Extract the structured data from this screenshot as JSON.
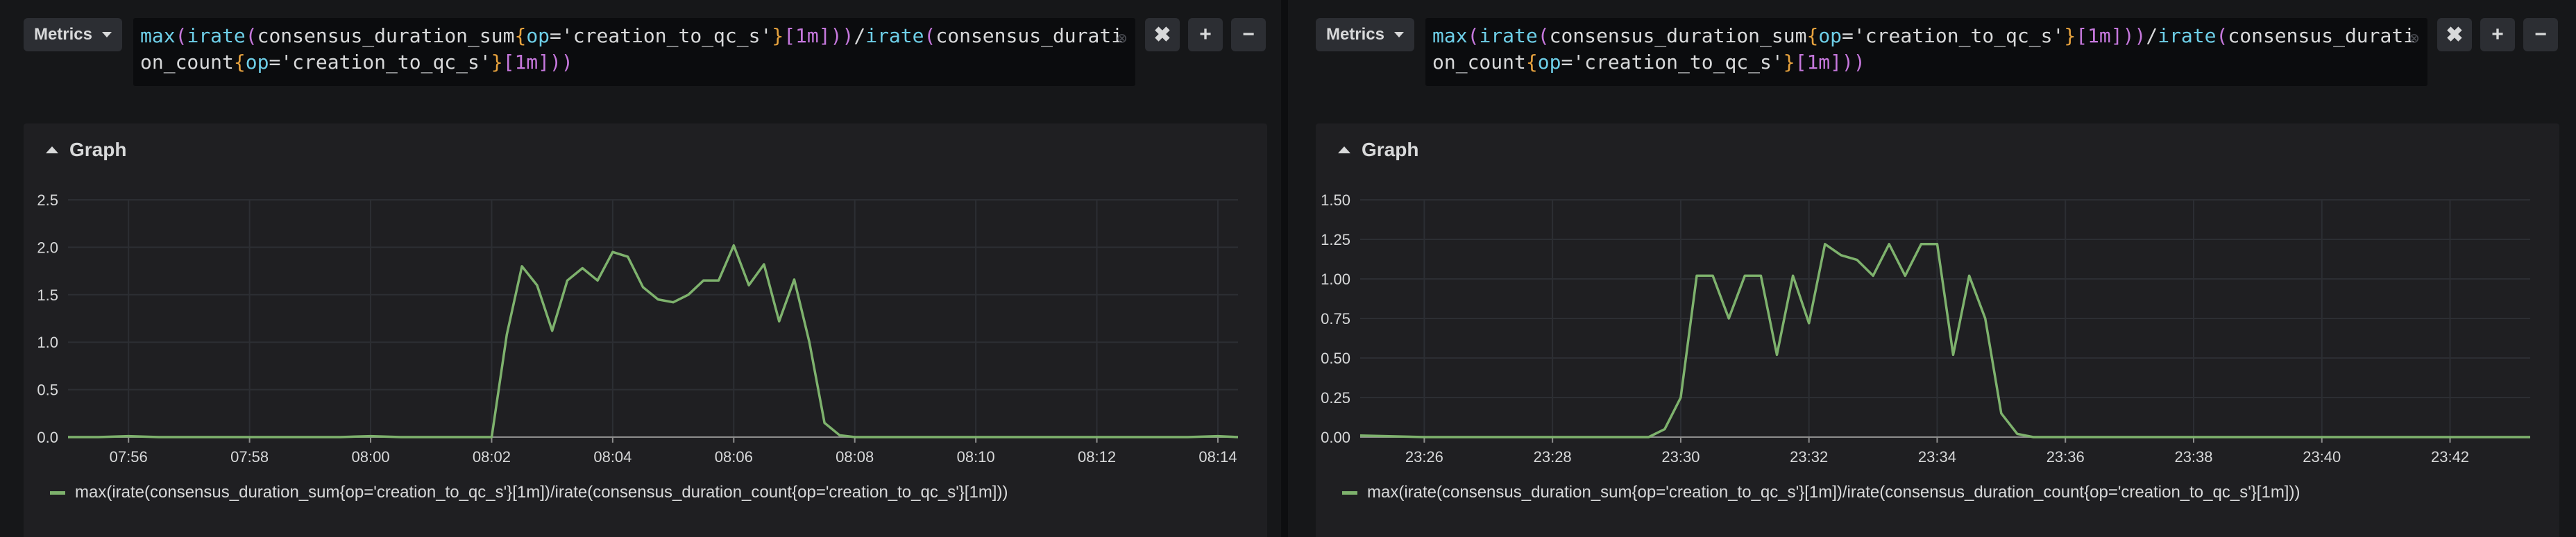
{
  "panels": [
    {
      "datasource_label": "Metrics",
      "query": {
        "segments": [
          {
            "t": "max",
            "c": "q-fn"
          },
          {
            "t": "(",
            "c": "q-par"
          },
          {
            "t": "irate",
            "c": "q-fn"
          },
          {
            "t": "(",
            "c": "q-par"
          },
          {
            "t": "consensus_duration_sum",
            "c": "q-metric"
          },
          {
            "t": "{",
            "c": "q-br"
          },
          {
            "t": "op",
            "c": "q-lbl"
          },
          {
            "t": "=",
            "c": "q-metric"
          },
          {
            "t": "'creation_to_qc_s'",
            "c": "q-metric"
          },
          {
            "t": "}",
            "c": "q-br"
          },
          {
            "t": "[1m]",
            "c": "q-dur"
          },
          {
            "t": ")",
            "c": "q-par"
          },
          {
            "t": ")",
            "c": "q-par"
          },
          {
            "t": "/",
            "c": "q-metric"
          },
          {
            "t": "irate",
            "c": "q-fn"
          },
          {
            "t": "(",
            "c": "q-par"
          },
          {
            "t": "consensus_duration_count",
            "c": "q-metric"
          },
          {
            "t": "{",
            "c": "q-br"
          },
          {
            "t": "op",
            "c": "q-lbl"
          },
          {
            "t": "=",
            "c": "q-metric"
          },
          {
            "t": "'creation_to_qc_s'",
            "c": "q-metric"
          },
          {
            "t": "}",
            "c": "q-br"
          },
          {
            "t": "[1m]",
            "c": "q-dur"
          },
          {
            "t": ")",
            "c": "q-par"
          },
          {
            "t": ")",
            "c": "q-par"
          }
        ]
      },
      "buttons": {
        "remove": "✖",
        "add": "+",
        "minus": "−"
      },
      "graph_title": "Graph",
      "legend": "max(irate(consensus_duration_sum{op='creation_to_qc_s'}[1m])/irate(consensus_duration_count{op='creation_to_qc_s'}[1m]))"
    },
    {
      "datasource_label": "Metrics",
      "query": {
        "segments": [
          {
            "t": "max",
            "c": "q-fn"
          },
          {
            "t": "(",
            "c": "q-par"
          },
          {
            "t": "irate",
            "c": "q-fn"
          },
          {
            "t": "(",
            "c": "q-par"
          },
          {
            "t": "consensus_duration_sum",
            "c": "q-metric"
          },
          {
            "t": "{",
            "c": "q-br"
          },
          {
            "t": "op",
            "c": "q-lbl"
          },
          {
            "t": "=",
            "c": "q-metric"
          },
          {
            "t": "'creation_to_qc_s'",
            "c": "q-metric"
          },
          {
            "t": "}",
            "c": "q-br"
          },
          {
            "t": "[1m]",
            "c": "q-dur"
          },
          {
            "t": ")",
            "c": "q-par"
          },
          {
            "t": ")",
            "c": "q-par"
          },
          {
            "t": "/",
            "c": "q-metric"
          },
          {
            "t": "irate",
            "c": "q-fn"
          },
          {
            "t": "(",
            "c": "q-par"
          },
          {
            "t": "consensus_duration_count",
            "c": "q-metric"
          },
          {
            "t": "{",
            "c": "q-br"
          },
          {
            "t": "op",
            "c": "q-lbl"
          },
          {
            "t": "=",
            "c": "q-metric"
          },
          {
            "t": "'creation_to_qc_s'",
            "c": "q-metric"
          },
          {
            "t": "}",
            "c": "q-br"
          },
          {
            "t": "[1m]",
            "c": "q-dur"
          },
          {
            "t": ")",
            "c": "q-par"
          },
          {
            "t": ")",
            "c": "q-par"
          }
        ]
      },
      "buttons": {
        "remove": "✖",
        "add": "+",
        "minus": "−"
      },
      "graph_title": "Graph",
      "legend": "max(irate(consensus_duration_sum{op='creation_to_qc_s'}[1m])/irate(consensus_duration_count{op='creation_to_qc_s'}[1m]))"
    }
  ],
  "chart_data": [
    {
      "type": "line",
      "title": "Graph",
      "line_color": "#7eb26d",
      "grid": true,
      "legend_position": "bottom-left",
      "x_ticks": [
        "07:56",
        "07:58",
        "08:00",
        "08:02",
        "08:04",
        "08:06",
        "08:08",
        "08:10",
        "08:12",
        "08:14"
      ],
      "y_ticks": [
        "0.0",
        "0.5",
        "1.0",
        "1.5",
        "2.0",
        "2.5"
      ],
      "ylim": [
        0,
        2.5
      ],
      "xlim": [
        "07:55",
        "08:14.333"
      ],
      "series": [
        {
          "name": "max(irate(consensus_duration_sum{op='creation_to_qc_s'}[1m])/irate(consensus_duration_count{op='creation_to_qc_s'}[1m]))",
          "x": [
            "07:55",
            "07:55:30",
            "07:56",
            "07:56:30",
            "07:57",
            "07:57:30",
            "07:58",
            "07:58:30",
            "07:59",
            "07:59:30",
            "08:00",
            "08:00:30",
            "08:01",
            "08:01:30",
            "08:02",
            "08:02:15",
            "08:02:30",
            "08:02:45",
            "08:03",
            "08:03:15",
            "08:03:30",
            "08:03:45",
            "08:04",
            "08:04:15",
            "08:04:30",
            "08:04:45",
            "08:05",
            "08:05:15",
            "08:05:30",
            "08:05:45",
            "08:06",
            "08:06:15",
            "08:06:30",
            "08:06:45",
            "08:07",
            "08:07:15",
            "08:07:30",
            "08:07:45",
            "08:08",
            "08:08:30",
            "08:09",
            "08:09:30",
            "08:10",
            "08:10:30",
            "08:11",
            "08:11:30",
            "08:12",
            "08:12:30",
            "08:13",
            "08:13:30",
            "08:14",
            "08:14:20"
          ],
          "y": [
            0,
            0,
            0.01,
            0,
            0,
            0,
            0,
            0,
            0,
            0,
            0.01,
            0,
            0,
            0,
            0,
            1.08,
            1.8,
            1.6,
            1.12,
            1.65,
            1.78,
            1.65,
            1.95,
            1.9,
            1.58,
            1.45,
            1.42,
            1.5,
            1.65,
            1.65,
            2.02,
            1.6,
            1.82,
            1.22,
            1.66,
            1.0,
            0.15,
            0.02,
            0,
            0,
            0,
            0,
            0,
            0,
            0,
            0,
            0,
            0,
            0,
            0,
            0.01,
            0
          ]
        }
      ]
    },
    {
      "type": "line",
      "title": "Graph",
      "line_color": "#7eb26d",
      "grid": true,
      "legend_position": "bottom-left",
      "x_ticks": [
        "23:26",
        "23:28",
        "23:30",
        "23:32",
        "23:34",
        "23:36",
        "23:38",
        "23:40",
        "23:42"
      ],
      "y_ticks": [
        "0.00",
        "0.25",
        "0.50",
        "0.75",
        "1.00",
        "1.25",
        "1.50"
      ],
      "ylim": [
        0,
        1.5
      ],
      "xlim": [
        "23:25",
        "23:43.25"
      ],
      "series": [
        {
          "name": "max(irate(consensus_duration_sum{op='creation_to_qc_s'}[1m])/irate(consensus_duration_count{op='creation_to_qc_s'}[1m]))",
          "x": [
            "23:25",
            "23:26",
            "23:27",
            "23:28",
            "23:29",
            "23:29:30",
            "23:29:45",
            "23:30",
            "23:30:15",
            "23:30:30",
            "23:30:45",
            "23:31",
            "23:31:15",
            "23:31:30",
            "23:31:45",
            "23:32",
            "23:32:15",
            "23:32:30",
            "23:32:45",
            "23:33",
            "23:33:15",
            "23:33:30",
            "23:33:45",
            "23:34",
            "23:34:15",
            "23:34:30",
            "23:34:45",
            "23:35",
            "23:35:15",
            "23:35:30",
            "23:36",
            "23:37",
            "23:38",
            "23:39",
            "23:40",
            "23:41",
            "23:42",
            "23:43.25"
          ],
          "y": [
            0.01,
            0,
            0,
            0,
            0,
            0,
            0.05,
            0.25,
            1.02,
            1.02,
            0.75,
            1.02,
            1.02,
            0.52,
            1.02,
            0.72,
            1.22,
            1.15,
            1.12,
            1.02,
            1.22,
            1.02,
            1.22,
            1.22,
            0.52,
            1.02,
            0.75,
            0.15,
            0.02,
            0,
            0,
            0,
            0,
            0,
            0,
            0,
            0,
            0
          ]
        }
      ]
    }
  ]
}
